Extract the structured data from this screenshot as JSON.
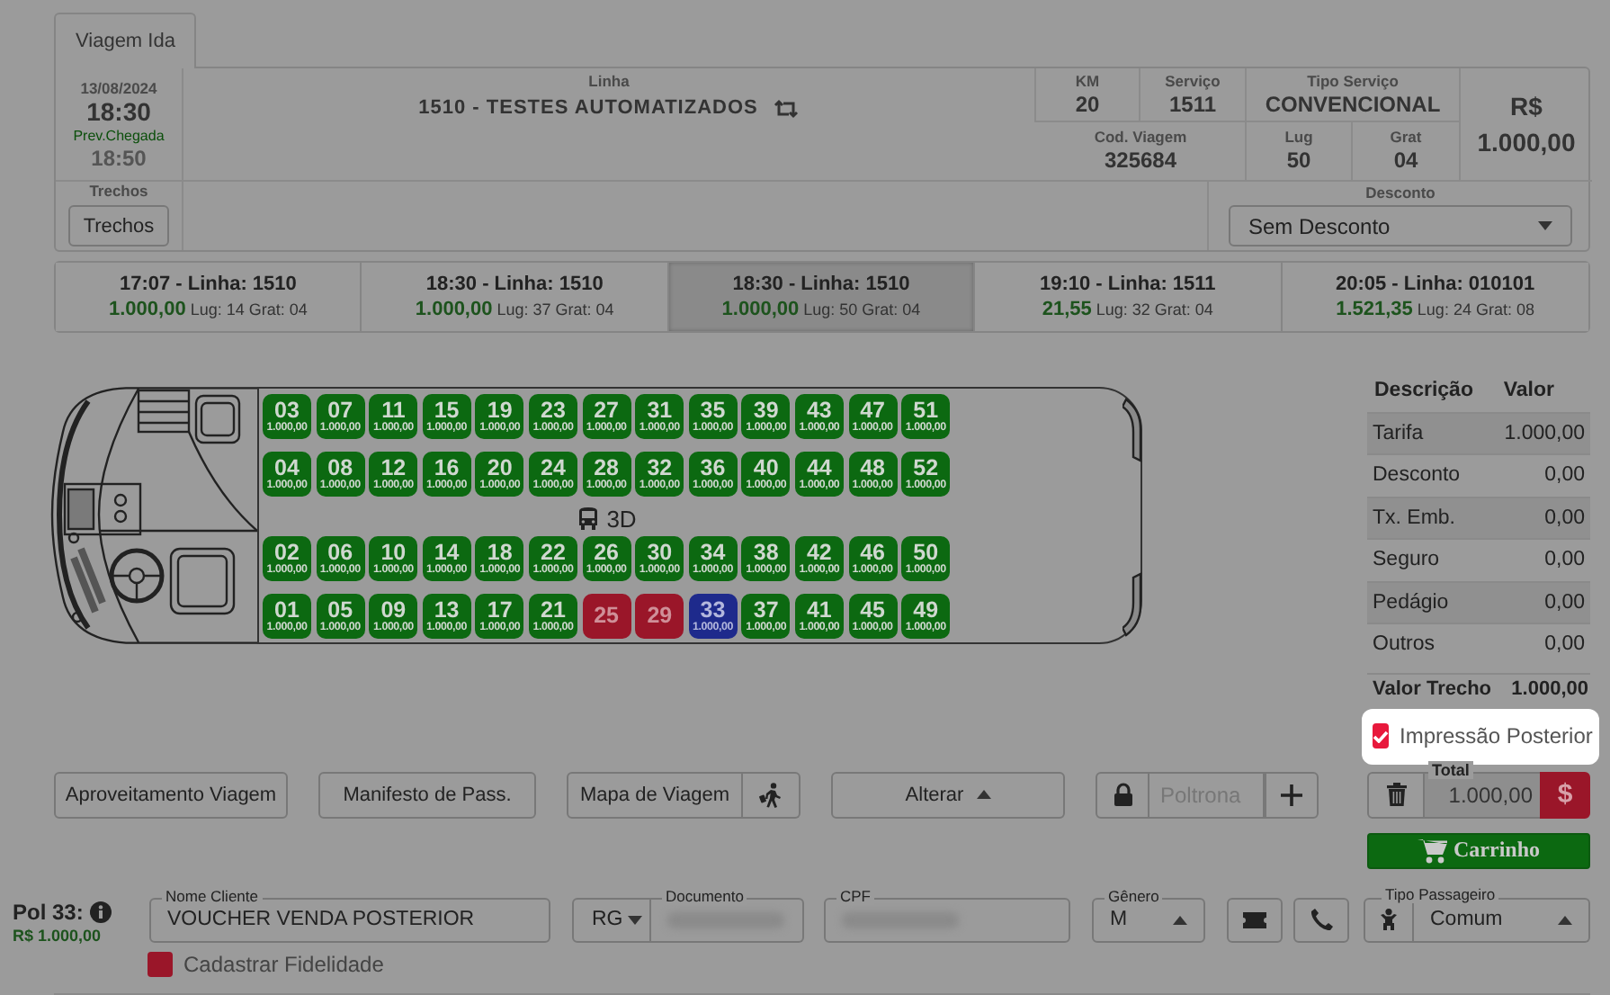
{
  "tabs": [
    {
      "label": "Viagem Ida",
      "selected": true
    }
  ],
  "trip": {
    "date": "13/08/2024",
    "departure": "18:30",
    "arrival_label": "Prev.Chegada",
    "arrival": "18:50",
    "line_label": "Linha",
    "line": "1510 - TESTES AUTOMATIZADOS",
    "km_label": "KM",
    "km": "20",
    "service_label": "Serviço",
    "service": "1511",
    "service_type_label": "Tipo Serviço",
    "service_type": "CONVENCIONAL",
    "trip_code_label": "Cod. Viagem",
    "trip_code": "325684",
    "seats_label": "Lug",
    "seats": "50",
    "free_label": "Grat",
    "free": "04",
    "currency": "R$",
    "price": "1.000,00",
    "segments_label": "Trechos",
    "segments_button": "Trechos",
    "discount_label": "Desconto",
    "discount": "Sem Desconto"
  },
  "departures": [
    {
      "title": "17:07 - Linha: 1510",
      "price": "1.000,00",
      "details": "Lug: 14 Grat: 04",
      "selected": false
    },
    {
      "title": "18:30 - Linha: 1510",
      "price": "1.000,00",
      "details": "Lug: 37 Grat: 04",
      "selected": false
    },
    {
      "title": "18:30 - Linha: 1510",
      "price": "1.000,00",
      "details": "Lug: 50 Grat: 04",
      "selected": true
    },
    {
      "title": "19:10 - Linha: 1511",
      "price": "21,55",
      "details": "Lug: 32 Grat: 04",
      "selected": false
    },
    {
      "title": "20:05 - Linha: 010101",
      "price": "1.521,35",
      "details": "Lug: 24 Grat: 08",
      "selected": false
    }
  ],
  "bus": {
    "floor_label": "3D",
    "seat_rows": [
      [
        {
          "number": "03",
          "price": "1.000,00",
          "kind": "free"
        },
        {
          "number": "07",
          "price": "1.000,00",
          "kind": "free"
        },
        {
          "number": "11",
          "price": "1.000,00",
          "kind": "free"
        },
        {
          "number": "15",
          "price": "1.000,00",
          "kind": "free"
        },
        {
          "number": "19",
          "price": "1.000,00",
          "kind": "free"
        },
        {
          "number": "23",
          "price": "1.000,00",
          "kind": "free"
        },
        {
          "number": "27",
          "price": "1.000,00",
          "kind": "free"
        },
        {
          "number": "31",
          "price": "1.000,00",
          "kind": "free"
        },
        {
          "number": "35",
          "price": "1.000,00",
          "kind": "free"
        },
        {
          "number": "39",
          "price": "1.000,00",
          "kind": "free"
        },
        {
          "number": "43",
          "price": "1.000,00",
          "kind": "free"
        },
        {
          "number": "47",
          "price": "1.000,00",
          "kind": "free"
        },
        {
          "number": "51",
          "price": "1.000,00",
          "kind": "free"
        }
      ],
      [
        {
          "number": "04",
          "price": "1.000,00",
          "kind": "free"
        },
        {
          "number": "08",
          "price": "1.000,00",
          "kind": "free"
        },
        {
          "number": "12",
          "price": "1.000,00",
          "kind": "free"
        },
        {
          "number": "16",
          "price": "1.000,00",
          "kind": "free"
        },
        {
          "number": "20",
          "price": "1.000,00",
          "kind": "free"
        },
        {
          "number": "24",
          "price": "1.000,00",
          "kind": "free"
        },
        {
          "number": "28",
          "price": "1.000,00",
          "kind": "free"
        },
        {
          "number": "32",
          "price": "1.000,00",
          "kind": "free"
        },
        {
          "number": "36",
          "price": "1.000,00",
          "kind": "free"
        },
        {
          "number": "40",
          "price": "1.000,00",
          "kind": "free"
        },
        {
          "number": "44",
          "price": "1.000,00",
          "kind": "free"
        },
        {
          "number": "48",
          "price": "1.000,00",
          "kind": "free"
        },
        {
          "number": "52",
          "price": "1.000,00",
          "kind": "free"
        }
      ],
      [
        {
          "number": "02",
          "price": "1.000,00",
          "kind": "free"
        },
        {
          "number": "06",
          "price": "1.000,00",
          "kind": "free"
        },
        {
          "number": "10",
          "price": "1.000,00",
          "kind": "free"
        },
        {
          "number": "14",
          "price": "1.000,00",
          "kind": "free"
        },
        {
          "number": "18",
          "price": "1.000,00",
          "kind": "free"
        },
        {
          "number": "22",
          "price": "1.000,00",
          "kind": "free"
        },
        {
          "number": "26",
          "price": "1.000,00",
          "kind": "free"
        },
        {
          "number": "30",
          "price": "1.000,00",
          "kind": "free"
        },
        {
          "number": "34",
          "price": "1.000,00",
          "kind": "free"
        },
        {
          "number": "38",
          "price": "1.000,00",
          "kind": "free"
        },
        {
          "number": "42",
          "price": "1.000,00",
          "kind": "free"
        },
        {
          "number": "46",
          "price": "1.000,00",
          "kind": "free"
        },
        {
          "number": "50",
          "price": "1.000,00",
          "kind": "free"
        }
      ],
      [
        {
          "number": "01",
          "price": "1.000,00",
          "kind": "free"
        },
        {
          "number": "05",
          "price": "1.000,00",
          "kind": "free"
        },
        {
          "number": "09",
          "price": "1.000,00",
          "kind": "free"
        },
        {
          "number": "13",
          "price": "1.000,00",
          "kind": "free"
        },
        {
          "number": "17",
          "price": "1.000,00",
          "kind": "free"
        },
        {
          "number": "21",
          "price": "1.000,00",
          "kind": "free"
        },
        {
          "number": "25",
          "kind": "occupied"
        },
        {
          "number": "29",
          "kind": "occupied"
        },
        {
          "number": "33",
          "price": "1.000,00",
          "kind": "selected"
        },
        {
          "number": "37",
          "price": "1.000,00",
          "kind": "free"
        },
        {
          "number": "41",
          "price": "1.000,00",
          "kind": "free"
        },
        {
          "number": "45",
          "price": "1.000,00",
          "kind": "free"
        },
        {
          "number": "49",
          "price": "1.000,00",
          "kind": "free"
        }
      ]
    ]
  },
  "fare": {
    "headers": [
      "Descrição",
      "Valor"
    ],
    "rows": [
      {
        "label": "Tarifa",
        "value": "1.000,00"
      },
      {
        "label": "Desconto",
        "value": "0,00"
      },
      {
        "label": "Tx. Emb.",
        "value": "0,00"
      },
      {
        "label": "Seguro",
        "value": "0,00"
      },
      {
        "label": "Pedágio",
        "value": "0,00"
      },
      {
        "label": "Outros",
        "value": "0,00"
      }
    ],
    "total": {
      "label": "Valor Trecho",
      "value": "1.000,00"
    }
  },
  "print_later": {
    "label": "Impressão Posterior",
    "checked": true
  },
  "actions": {
    "buttons": [
      "Aproveitamento Viagem",
      "Manifesto de Pass.",
      "Mapa de Viagem"
    ],
    "alter_button": "Alterar",
    "seat_field": {
      "placeholder": "Poltrona"
    },
    "total_label": "Total",
    "total": "1.000,00",
    "pay_button": "$",
    "cart_button": "Carrinho"
  },
  "passenger": {
    "seat_label": "Pol 33:",
    "seat_price": "R$ 1.000,00",
    "name_label": "Nome Cliente",
    "name": "VOUCHER VENDA POSTERIOR",
    "doc_type": "RG",
    "doc_label": "Documento",
    "cpf_label": "CPF",
    "gender_label": "Gênero",
    "gender": "M",
    "type_label": "Tipo Passageiro",
    "type": "Comum",
    "loyalty": {
      "label": "Cadastrar Fidelidade",
      "checked": false
    }
  }
}
